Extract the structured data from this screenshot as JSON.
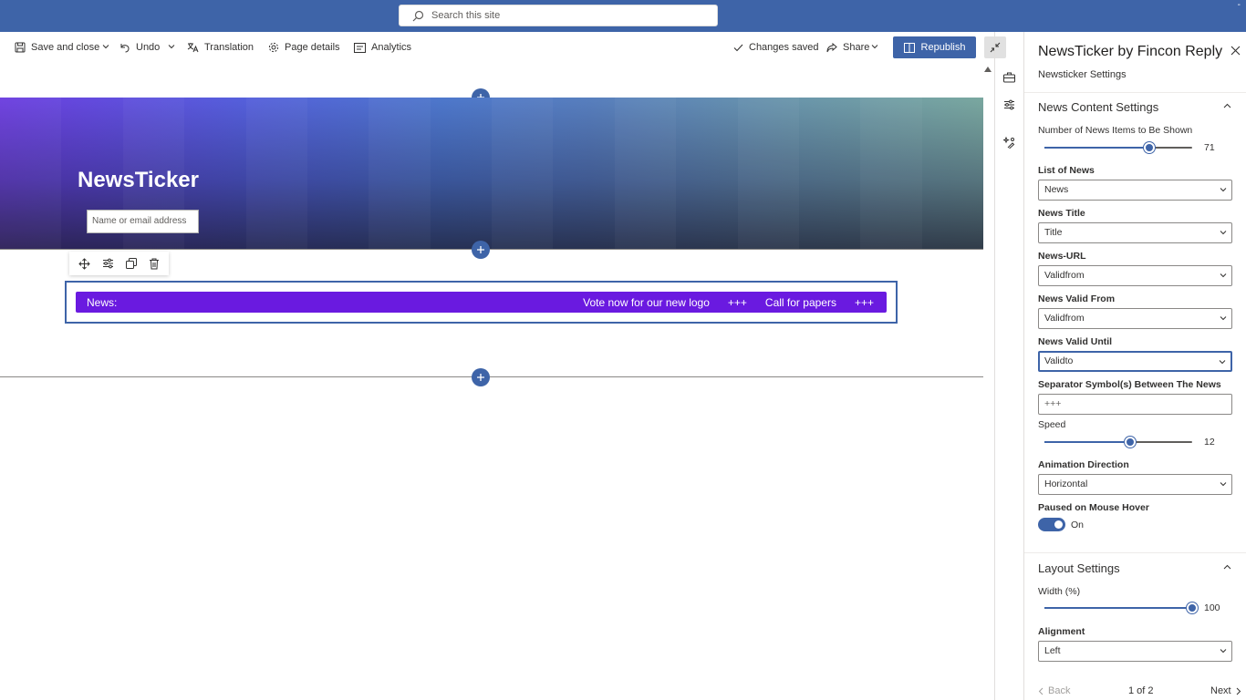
{
  "suitebar": {
    "search_placeholder": "Search this site",
    "window_control": "-"
  },
  "commandbar": {
    "save_close": "Save and close",
    "undo": "Undo",
    "translation": "Translation",
    "page_details": "Page details",
    "analytics": "Analytics",
    "status": "Changes saved",
    "share": "Share",
    "republish": "Republish"
  },
  "canvas": {
    "hero_title": "NewsTicker",
    "people_placeholder": "Name or email address",
    "ticker": {
      "label": "News:",
      "items": [
        "Vote now for our new logo",
        "+++",
        "Call for papers",
        "+++"
      ],
      "bg_color": "#6a1ae0"
    }
  },
  "pane": {
    "title": "NewsTicker by Fincon Reply",
    "subtitle": "Newsticker Settings",
    "content_group": "News Content Settings",
    "num_items_label": "Number of News Items to Be Shown",
    "num_items_value": "71",
    "num_items_fraction": 0.71,
    "list_label": "List of News",
    "list_value": "News",
    "title_label": "News Title",
    "title_value": "Title",
    "url_label": "News-URL",
    "url_value": "Validfrom",
    "valid_from_label": "News Valid From",
    "valid_from_value": "Validfrom",
    "valid_until_label": "News Valid Until",
    "valid_until_value": "Validto",
    "separator_label": "Separator Symbol(s) Between The News",
    "separator_value": "+++",
    "speed_label": "Speed",
    "speed_value": "12",
    "speed_fraction": 0.58,
    "direction_label": "Animation Direction",
    "direction_value": "Horizontal",
    "hover_label": "Paused on Mouse Hover",
    "hover_value": "On",
    "layout_group": "Layout Settings",
    "width_label": "Width (%)",
    "width_value": "100",
    "width_fraction": 1.0,
    "alignment_label": "Alignment",
    "alignment_value": "Left",
    "back": "Back",
    "page_indicator": "1 of 2",
    "next": "Next"
  },
  "colors": {
    "accent": "#3e64a8",
    "suitebar": "#3e64a8"
  }
}
